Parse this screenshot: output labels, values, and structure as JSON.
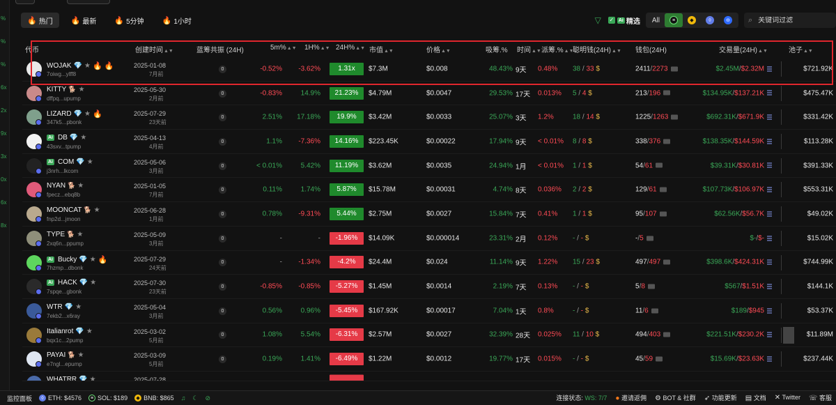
{
  "edge_labels": [
    "%",
    "%",
    "%",
    "6x",
    "2x",
    "9x",
    "3x",
    "0x",
    "6x",
    "8x"
  ],
  "tabs": [
    {
      "label": "热门",
      "active": true
    },
    {
      "label": "最新",
      "active": false
    },
    {
      "label": "5分钟",
      "active": false
    },
    {
      "label": "1小时",
      "active": false
    }
  ],
  "toolbar": {
    "ai": "Ai",
    "jingxuan": "精选",
    "chain_all": "All",
    "search_placeholder": "关键词过滤"
  },
  "headers": {
    "token": "代币",
    "created": "创建时间",
    "bluechip": "蓝筹共振 (24H)",
    "m5": "5m%",
    "h1": "1H%",
    "h24": "24H%",
    "mcap": "市值",
    "price": "价格",
    "absorb": "吸筹.%",
    "time": "时间",
    "distribute": "派筹.%",
    "smart": "聪明钱(24H)",
    "wallet": "钱包(24H)",
    "volume": "交易量(24H)",
    "pool": "池子"
  },
  "rows": [
    {
      "sym": "WOJAK",
      "ai": false,
      "dog": false,
      "fires": 2,
      "addr": "7oiwg...ylff8",
      "date": "2025-01-08",
      "ago": "7月前",
      "blue": "0",
      "m5": "-0.52%",
      "m5c": "red",
      "h1": "-3.62%",
      "h1c": "red",
      "h24": "1.31x",
      "h24pos": true,
      "mcap": "$7.3M",
      "price": "$0.008",
      "absorb": "48.43%",
      "time": "9天",
      "dist": "0.48%",
      "sm1": "38",
      "sm2": "33",
      "w1": "2411",
      "w2": "2273",
      "v1": "$2.45M",
      "v2": "$2.32M",
      "pool": "$721.92K",
      "avatar": "#e8e8e8"
    },
    {
      "sym": "KITTY",
      "ai": false,
      "dog": true,
      "fires": 0,
      "addr": "dffpq...upump",
      "date": "2025-05-30",
      "ago": "2月前",
      "blue": "0",
      "m5": "-0.83%",
      "m5c": "red",
      "h1": "14.9%",
      "h1c": "g",
      "h24": "21.23%",
      "h24pos": true,
      "mcap": "$4.79M",
      "price": "$0.0047",
      "absorb": "29.53%",
      "time": "17天",
      "dist": "0.013%",
      "sm1": "5",
      "sm2": "4",
      "w1": "213",
      "w2": "196",
      "v1": "$134.95K",
      "v2": "$137.21K",
      "pool": "$475.47K",
      "avatar": "#c98a8a"
    },
    {
      "sym": "LIZARD",
      "ai": false,
      "dog": false,
      "fires": 1,
      "addr": "347k5...pbonk",
      "date": "2025-07-29",
      "ago": "23天前",
      "blue": "0",
      "m5": "2.51%",
      "m5c": "g",
      "h1": "17.18%",
      "h1c": "g",
      "h24": "19.9%",
      "h24pos": true,
      "mcap": "$3.42M",
      "price": "$0.0033",
      "absorb": "25.07%",
      "time": "3天",
      "dist": "1.2%",
      "sm1": "18",
      "sm2": "14",
      "w1": "1225",
      "w2": "1263",
      "v1": "$692.31K",
      "v2": "$671.9K",
      "pool": "$331.42K",
      "avatar": "#7fa08c"
    },
    {
      "sym": "DB",
      "ai": true,
      "dog": false,
      "fires": 0,
      "addr": "43sxv...tpump",
      "date": "2025-04-13",
      "ago": "4月前",
      "blue": "0",
      "m5": "1.1%",
      "m5c": "g",
      "h1": "-7.36%",
      "h1c": "red",
      "h24": "14.16%",
      "h24pos": true,
      "mcap": "$223.45K",
      "price": "$0.00022",
      "absorb": "17.94%",
      "time": "9天",
      "dist": "< 0.01%",
      "sm1": "8",
      "sm2": "8",
      "w1": "338",
      "w2": "376",
      "v1": "$138.35K",
      "v2": "$144.59K",
      "pool": "$113.28K",
      "avatar": "#f2f2f2"
    },
    {
      "sym": "COM",
      "ai": true,
      "dog": false,
      "fires": 0,
      "addr": "j3nrh...lkcom",
      "date": "2025-05-06",
      "ago": "3月前",
      "blue": "0",
      "m5": "< 0.01%",
      "m5c": "g",
      "h1": "5.42%",
      "h1c": "g",
      "h24": "11.19%",
      "h24pos": true,
      "mcap": "$3.62M",
      "price": "$0.0035",
      "absorb": "24.94%",
      "time": "1月",
      "dist": "< 0.01%",
      "sm1": "1",
      "sm2": "1",
      "w1": "54",
      "w2": "61",
      "v1": "$39.31K",
      "v2": "$30.81K",
      "pool": "$391.33K",
      "avatar": "#222222"
    },
    {
      "sym": "NYAN",
      "ai": false,
      "dog": true,
      "fires": 0,
      "addr": "fpecz...ebq8b",
      "date": "2025-01-05",
      "ago": "7月前",
      "blue": "0",
      "m5": "0.11%",
      "m5c": "g",
      "h1": "1.74%",
      "h1c": "g",
      "h24": "5.87%",
      "h24pos": true,
      "mcap": "$15.78M",
      "price": "$0.00031",
      "absorb": "4.74%",
      "time": "8天",
      "dist": "0.036%",
      "sm1": "2",
      "sm2": "2",
      "w1": "129",
      "w2": "61",
      "v1": "$107.73K",
      "v2": "$106.97K",
      "pool": "$553.31K",
      "avatar": "#e05a7a"
    },
    {
      "sym": "MOONCAT",
      "ai": false,
      "dog": true,
      "fires": 0,
      "addr": "fnp2d...jmoon",
      "date": "2025-06-28",
      "ago": "1月前",
      "blue": "0",
      "m5": "0.78%",
      "m5c": "g",
      "h1": "-9.31%",
      "h1c": "red",
      "h24": "5.44%",
      "h24pos": true,
      "mcap": "$2.75M",
      "price": "$0.0027",
      "absorb": "15.84%",
      "time": "7天",
      "dist": "0.41%",
      "sm1": "1",
      "sm2": "1",
      "w1": "95",
      "w2": "107",
      "v1": "$62.56K",
      "v2": "$56.7K",
      "pool": "$49.02K",
      "avatar": "#b9a98e"
    },
    {
      "sym": "TYPE",
      "ai": false,
      "dog": true,
      "fires": 0,
      "addr": "2xq6n...ppump",
      "date": "2025-05-09",
      "ago": "3月前",
      "blue": "0",
      "m5": "-",
      "m5c": "m",
      "h1": "-",
      "h1c": "m",
      "h24": "-1.96%",
      "h24pos": false,
      "mcap": "$14.09K",
      "price": "$0.000014",
      "absorb": "23.31%",
      "time": "2月",
      "dist": "0.12%",
      "sm1": "-",
      "sm2": "-",
      "w1": "-",
      "w2": "5",
      "v1": "$-",
      "v2": "$-",
      "pool": "$15.02K",
      "avatar": "#8f8f7a"
    },
    {
      "sym": "Bucky",
      "ai": true,
      "dog": false,
      "fires": 1,
      "addr": "7hzmp...dbonk",
      "date": "2025-07-29",
      "ago": "24天前",
      "blue": "0",
      "m5": "-",
      "m5c": "m",
      "h1": "-1.34%",
      "h1c": "red",
      "h24": "-4.2%",
      "h24pos": false,
      "mcap": "$24.4M",
      "price": "$0.024",
      "absorb": "11.14%",
      "time": "9天",
      "dist": "1.22%",
      "sm1": "15",
      "sm2": "23",
      "w1": "497",
      "w2": "497",
      "v1": "$398.6K",
      "v2": "$424.31K",
      "pool": "$744.99K",
      "avatar": "#5ed65e"
    },
    {
      "sym": "HACK",
      "ai": true,
      "dog": false,
      "fires": 0,
      "addr": "7spqe...gbonk",
      "date": "2025-07-30",
      "ago": "23天前",
      "blue": "0",
      "m5": "-0.85%",
      "m5c": "red",
      "h1": "-0.85%",
      "h1c": "red",
      "h24": "-5.27%",
      "h24pos": false,
      "mcap": "$1.45M",
      "price": "$0.0014",
      "absorb": "2.19%",
      "time": "7天",
      "dist": "0.13%",
      "sm1": "-",
      "sm2": "-",
      "w1": "5",
      "w2": "8",
      "v1": "$567",
      "v2": "$1.51K",
      "pool": "$144.1K",
      "avatar": "#2a2a2a"
    },
    {
      "sym": "WTR",
      "ai": false,
      "dog": false,
      "fires": 0,
      "addr": "7ekb2...x6ray",
      "date": "2025-05-04",
      "ago": "3月前",
      "blue": "0",
      "m5": "0.56%",
      "m5c": "g",
      "h1": "0.96%",
      "h1c": "g",
      "h24": "-5.45%",
      "h24pos": false,
      "mcap": "$167.92K",
      "price": "$0.00017",
      "absorb": "7.04%",
      "time": "1天",
      "dist": "0.8%",
      "sm1": "-",
      "sm2": "-",
      "w1": "11",
      "w2": "6",
      "v1": "$189",
      "v2": "$945",
      "pool": "$53.37K",
      "avatar": "#3a5a9a"
    },
    {
      "sym": "Italianrot",
      "ai": false,
      "dog": false,
      "fires": 0,
      "addr": "bqx1c...2pump",
      "date": "2025-03-02",
      "ago": "5月前",
      "blue": "0",
      "m5": "1.08%",
      "m5c": "g",
      "h1": "5.54%",
      "h1c": "g",
      "h24": "-6.31%",
      "h24pos": false,
      "mcap": "$2.57M",
      "price": "$0.0027",
      "absorb": "32.39%",
      "time": "28天",
      "dist": "0.025%",
      "sm1": "11",
      "sm2": "10",
      "w1": "494",
      "w2": "403",
      "v1": "$221.51K",
      "v2": "$230.2K",
      "pool": "$11.89M",
      "avatar": "#9a7a3a"
    },
    {
      "sym": "PAYAI",
      "ai": false,
      "dog": true,
      "fires": 0,
      "addr": "e7ngl...epump",
      "date": "2025-03-09",
      "ago": "5月前",
      "blue": "0",
      "m5": "0.19%",
      "m5c": "g",
      "h1": "1.41%",
      "h1c": "g",
      "h24": "-6.49%",
      "h24pos": false,
      "mcap": "$1.22M",
      "price": "$0.0012",
      "absorb": "19.77%",
      "time": "17天",
      "dist": "0.015%",
      "sm1": "-",
      "sm2": "-",
      "w1": "45",
      "w2": "59",
      "v1": "$15.69K",
      "v2": "$23.63K",
      "pool": "$237.44K",
      "avatar": "#dfe6f2"
    },
    {
      "sym": "WHATRR",
      "ai": false,
      "dog": false,
      "fires": 0,
      "addr": "",
      "date": "2025-07-28",
      "ago": "",
      "blue": "",
      "m5": "",
      "m5c": "m",
      "h1": "",
      "h1c": "m",
      "h24": "",
      "h24pos": false,
      "mcap": "",
      "price": "",
      "absorb": "",
      "time": "",
      "dist": "",
      "sm1": "",
      "sm2": "",
      "w1": "",
      "w2": "",
      "v1": "",
      "v2": "",
      "pool": "",
      "avatar": "#4a6aa8"
    }
  ],
  "statusbar": {
    "monitor": "监控面板",
    "eth": "ETH: $4576",
    "sol": "SOL: $189",
    "bnb": "BNB: $865",
    "conn_label": "连接状态:",
    "ws": "WS: 7/7",
    "invite": "邀请返佣",
    "bot": "BOT & 社群",
    "update": "功能更新",
    "docs": "文档",
    "twitter": "Twitter",
    "extra": "客服"
  },
  "colors": {
    "accent_green": "#3aa757",
    "negative_red": "#e53a47",
    "highlight_border": "#e0262d"
  }
}
